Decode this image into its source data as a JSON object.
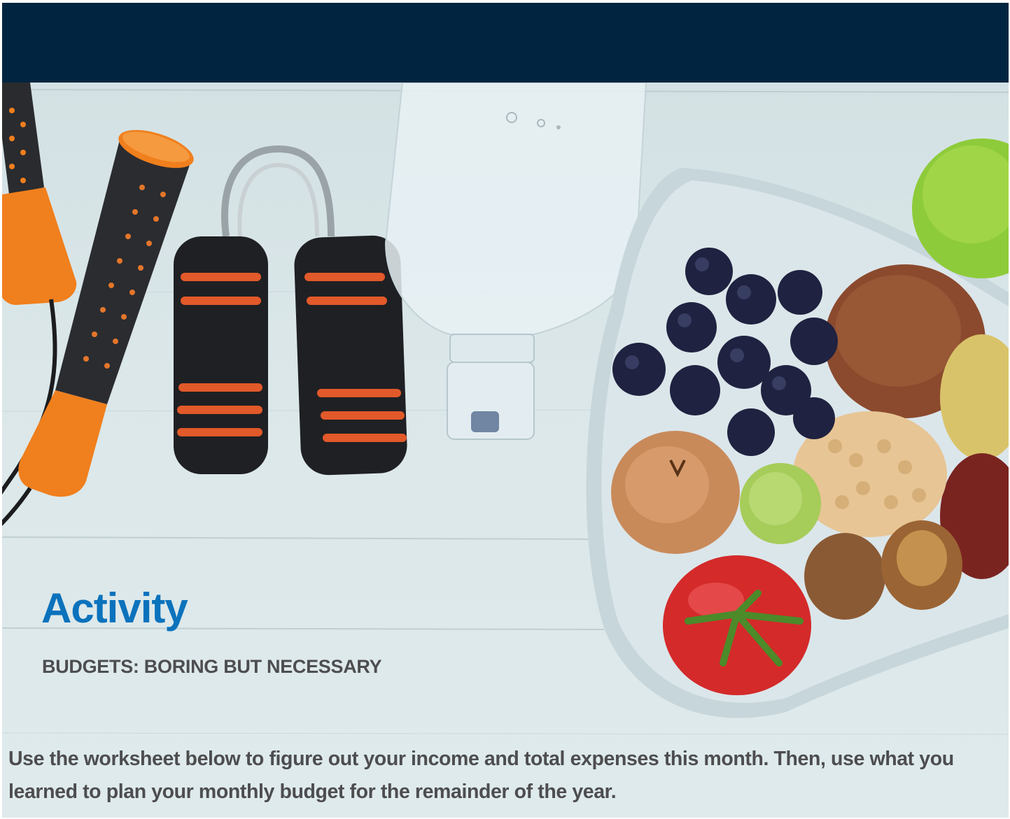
{
  "header": {
    "band_color": "#012540"
  },
  "hero_image": {
    "description_icons": [
      "jump-rope-handle-icon",
      "hand-grip-icon",
      "water-bottle-icon",
      "fruit-vegetable-plate-icon",
      "apple-icon"
    ]
  },
  "activity": {
    "title": "Activity",
    "subtitle": "BUDGETS: BORING BUT NECESSARY",
    "instructions": "Use the worksheet below to figure out your income and total expenses this month. Then, use what you learned to plan your monthly budget for the remainder of the year.",
    "title_color": "#0b72bc",
    "text_color": "#4d4d4f"
  }
}
